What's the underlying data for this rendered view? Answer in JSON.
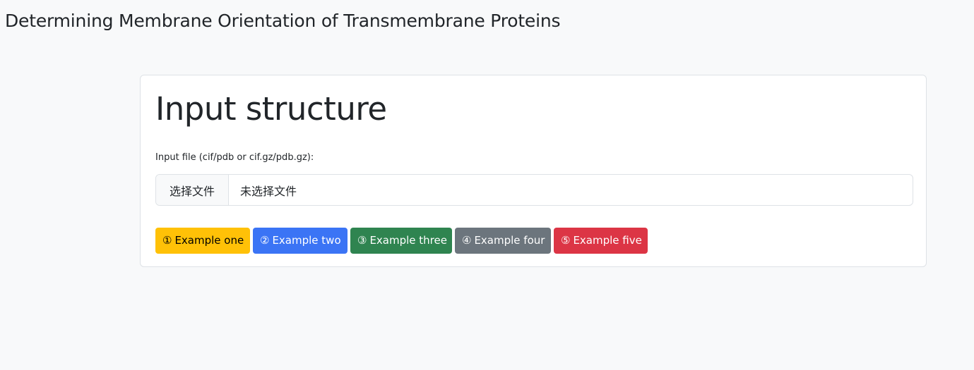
{
  "header": {
    "title": "Determining Membrane Orientation of Transmembrane Proteins"
  },
  "card": {
    "title": "Input structure",
    "file_label": "Input file (cif/pdb or cif.gz/pdb.gz):",
    "file_button": "选择文件",
    "file_status": "未选择文件"
  },
  "examples": [
    {
      "icon": "①",
      "label": "Example one",
      "color": "#ffc107"
    },
    {
      "icon": "②",
      "label": "Example two",
      "color": "#3b74f5"
    },
    {
      "icon": "③",
      "label": "Example three",
      "color": "#2f8450"
    },
    {
      "icon": "④",
      "label": "Example four",
      "color": "#6c757d"
    },
    {
      "icon": "⑤",
      "label": "Example five",
      "color": "#dc3545"
    }
  ]
}
